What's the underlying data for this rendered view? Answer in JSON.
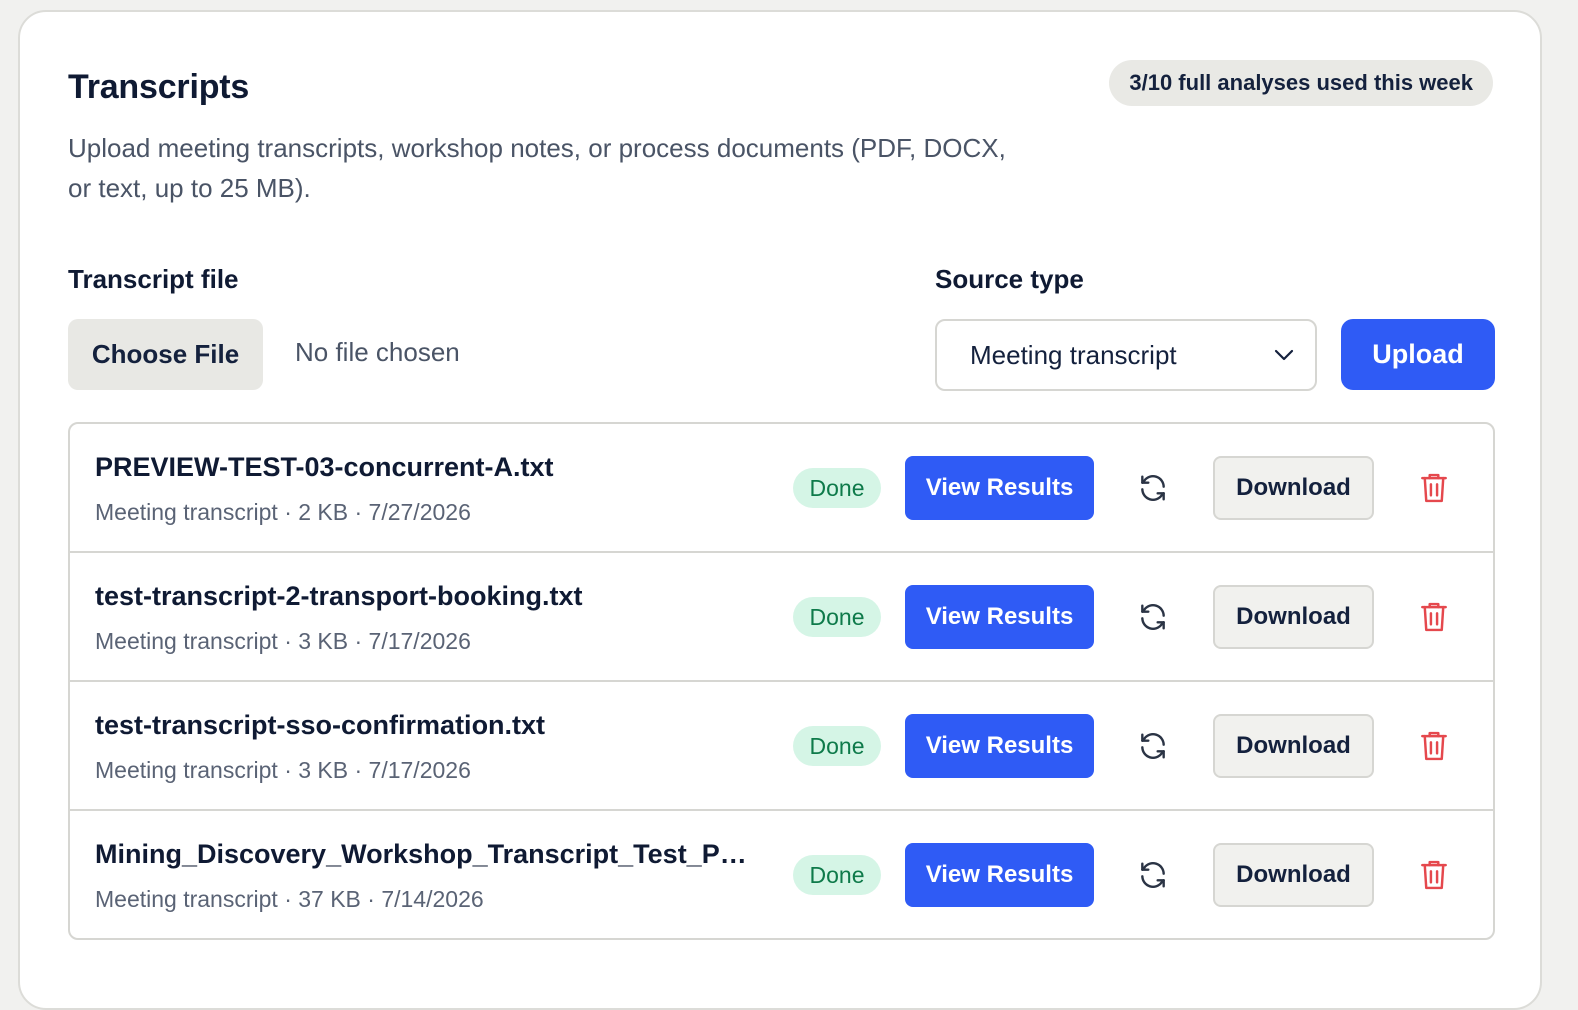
{
  "header": {
    "title": "Transcripts",
    "usage": "3/10 full analyses used this week",
    "description": "Upload meeting transcripts, workshop notes, or process documents (PDF, DOCX, or text, up to 25 MB)."
  },
  "form": {
    "file_label": "Transcript file",
    "choose_file_label": "Choose File",
    "no_file_text": "No file chosen",
    "source_label": "Source type",
    "source_value": "Meeting transcript",
    "upload_label": "Upload"
  },
  "files": [
    {
      "name": "PREVIEW-TEST-03-concurrent-A.txt",
      "meta": "Meeting transcript · 2 KB · 7/27/2026",
      "status": "Done"
    },
    {
      "name": "test-transcript-2-transport-booking.txt",
      "meta": "Meeting transcript · 3 KB · 7/17/2026",
      "status": "Done"
    },
    {
      "name": "test-transcript-sso-confirmation.txt",
      "meta": "Meeting transcript · 3 KB · 7/17/2026",
      "status": "Done"
    },
    {
      "name": "Mining_Discovery_Workshop_Transcript_Test_Pac...",
      "meta": "Meeting transcript · 37 KB · 7/14/2026",
      "status": "Done"
    }
  ],
  "actions": {
    "view_label": "View Results",
    "download_label": "Download",
    "refresh_icon": "refresh-icon",
    "delete_icon": "trash-icon"
  },
  "colors": {
    "primary": "#2f5bf5",
    "done_bg": "#d5f5e6",
    "done_text": "#0e7a4a",
    "danger": "#e5484d"
  }
}
